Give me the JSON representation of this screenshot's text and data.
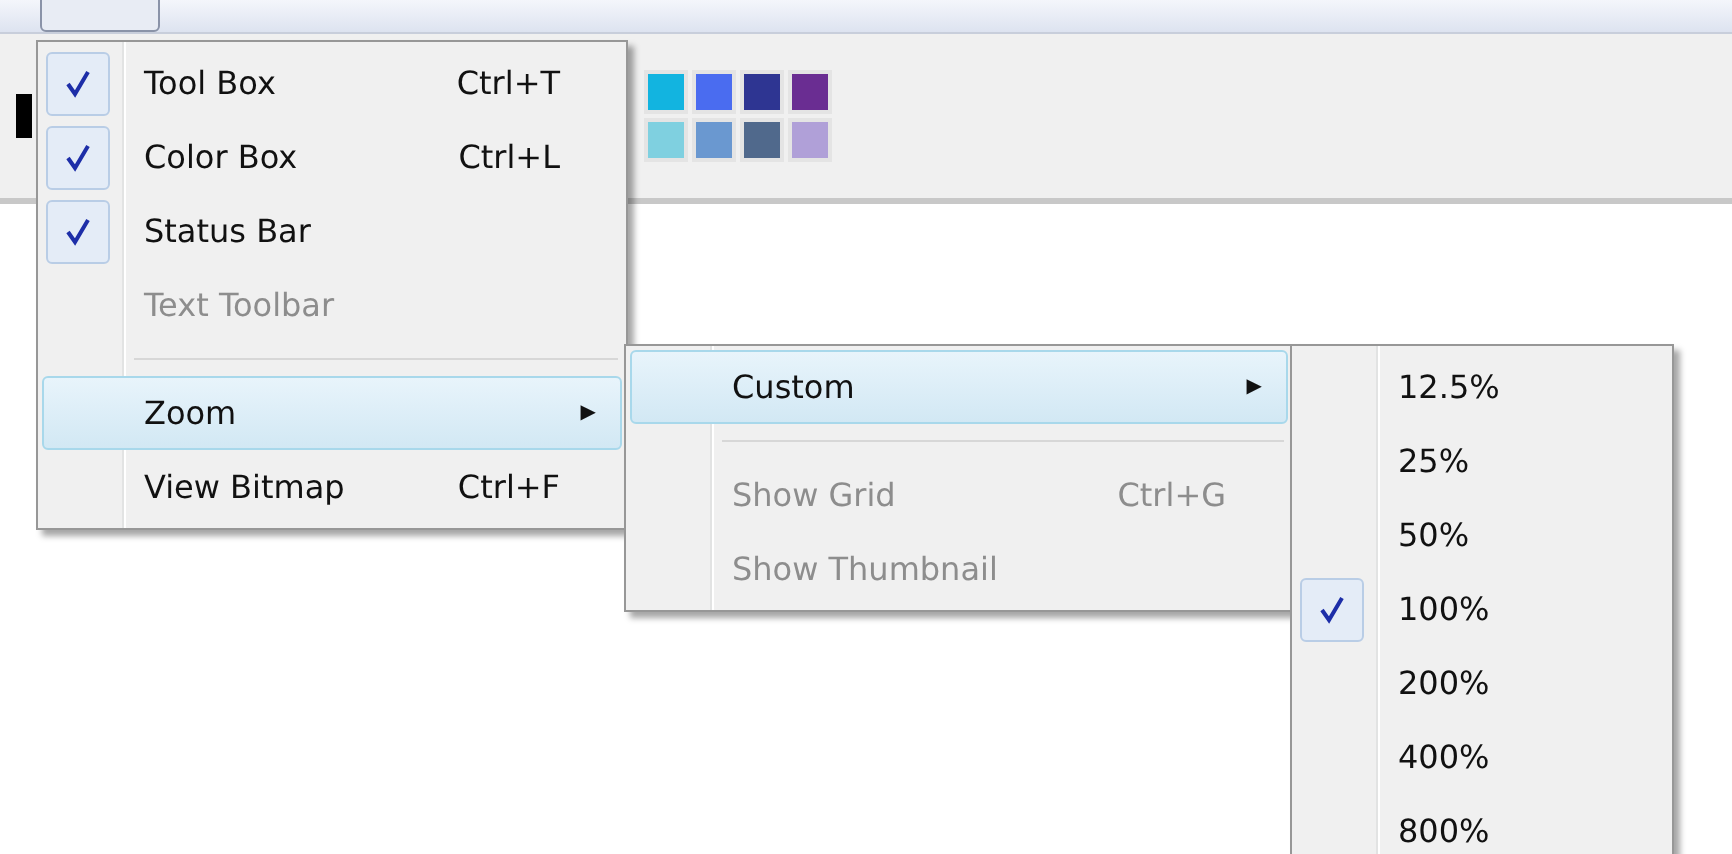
{
  "palette": [
    {
      "color": "#12b4e0"
    },
    {
      "color": "#4a6cf0"
    },
    {
      "color": "#2e3592"
    },
    {
      "color": "#6a2d92"
    },
    {
      "color": "#7fd0e0"
    },
    {
      "color": "#6a98d0"
    },
    {
      "color": "#50698c"
    },
    {
      "color": "#b0a0d8"
    }
  ],
  "view_menu": {
    "items": [
      {
        "kind": "item",
        "label": "Tool Box",
        "shortcut": "Ctrl+T",
        "checked": true,
        "disabled": false,
        "highlighted": false
      },
      {
        "kind": "item",
        "label": "Color Box",
        "shortcut": "Ctrl+L",
        "checked": true,
        "disabled": false,
        "highlighted": false
      },
      {
        "kind": "item",
        "label": "Status Bar",
        "checked": true,
        "disabled": false,
        "highlighted": false
      },
      {
        "kind": "item",
        "label": "Text Toolbar",
        "checked": false,
        "disabled": true,
        "highlighted": false
      },
      {
        "kind": "separator"
      },
      {
        "kind": "submenu",
        "label": "Zoom",
        "arrow": "▶",
        "checked": false,
        "disabled": false,
        "highlighted": true
      },
      {
        "kind": "item",
        "label": "View Bitmap",
        "shortcut": "Ctrl+F",
        "checked": false,
        "disabled": false,
        "highlighted": false
      }
    ]
  },
  "zoom_menu": {
    "items": [
      {
        "kind": "submenu",
        "label": "Custom",
        "arrow": "▶",
        "checked": false,
        "disabled": false,
        "highlighted": true
      },
      {
        "kind": "separator"
      },
      {
        "kind": "item",
        "label": "Show Grid",
        "shortcut": "Ctrl+G",
        "checked": false,
        "disabled": true,
        "highlighted": false
      },
      {
        "kind": "item",
        "label": "Show Thumbnail",
        "checked": false,
        "disabled": true,
        "highlighted": false
      }
    ]
  },
  "custom_menu": {
    "items": [
      {
        "kind": "item",
        "label": "12.5%",
        "checked": false,
        "disabled": false,
        "highlighted": false
      },
      {
        "kind": "item",
        "label": "25%",
        "checked": false,
        "disabled": false,
        "highlighted": false
      },
      {
        "kind": "item",
        "label": "50%",
        "checked": false,
        "disabled": false,
        "highlighted": false
      },
      {
        "kind": "item",
        "label": "100%",
        "checked": true,
        "disabled": false,
        "highlighted": false
      },
      {
        "kind": "item",
        "label": "200%",
        "checked": false,
        "disabled": false,
        "highlighted": false
      },
      {
        "kind": "item",
        "label": "400%",
        "checked": false,
        "disabled": false,
        "highlighted": false
      },
      {
        "kind": "item",
        "label": "800%",
        "checked": false,
        "disabled": false,
        "highlighted": false
      }
    ]
  }
}
